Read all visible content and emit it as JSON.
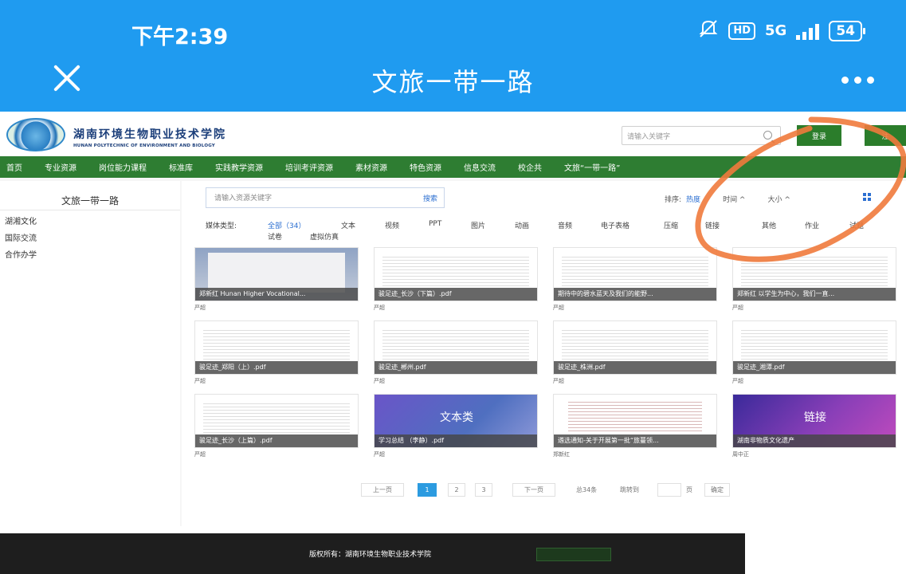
{
  "status_bar": {
    "time": "下午2:39",
    "network": "5G",
    "battery": "54"
  },
  "app_bar": {
    "title": "文旅一带一路"
  },
  "site": {
    "name_cn": "湖南环境生物职业技术学院",
    "name_en": "HUNAN POLYTECHNIC OF ENVIRONMENT AND BIOLOGY",
    "search_placeholder": "请输入关键字",
    "login_label": "登录",
    "register_label": "注"
  },
  "nav": {
    "items": [
      "首页",
      "专业资源",
      "岗位能力课程",
      "标准库",
      "实践教学资源",
      "培训考评资源",
      "素材资源",
      "特色资源",
      "信息交流",
      "校企共",
      "文旅“一带一路”"
    ]
  },
  "sidebar": {
    "title": "文旅一带一路",
    "items": [
      "湖湘文化",
      "国际交流",
      "合作办学"
    ]
  },
  "resource_search": {
    "placeholder": "请输入资源关键字",
    "button": "搜索"
  },
  "sort": {
    "label": "排序:",
    "options": [
      "热度",
      "时间 ^",
      "大小 ^"
    ]
  },
  "media": {
    "label": "媒体类型:",
    "options": [
      "全部（34）",
      "文本",
      "视频",
      "PPT",
      "图片",
      "动画",
      "音频",
      "电子表格",
      "压缩",
      "链接",
      "其他",
      "作业",
      "试题",
      "试卷",
      "虚拟仿真"
    ]
  },
  "cards": [
    {
      "title": "郑新红 Hunan Higher Vocational...",
      "author": "严超",
      "style": "cert"
    },
    {
      "title": "骏足迹_长沙（下篇）.pdf",
      "author": "严超",
      "style": "doc"
    },
    {
      "title": "期待中的碧水蓝天及我们的能野...",
      "author": "严超",
      "style": "doc"
    },
    {
      "title": "郑新红 以学生为中心，我们一直...",
      "author": "严超",
      "style": "doc"
    },
    {
      "title": "骏足迹_郑阳（上）.pdf",
      "author": "严超",
      "style": "doc"
    },
    {
      "title": "骏足迹_郴州.pdf",
      "author": "严超",
      "style": "doc"
    },
    {
      "title": "骏足迹_株洲.pdf",
      "author": "严超",
      "style": "doc"
    },
    {
      "title": "骏足迹_湘潭.pdf",
      "author": "严超",
      "style": "doc"
    },
    {
      "title": "骏足迹_长沙（上篇）.pdf",
      "author": "严超",
      "style": "doc"
    },
    {
      "title": "学习总结 （李静）.pdf",
      "author": "严超",
      "style": "purple1",
      "thumb_text": "文本类"
    },
    {
      "title": "遴选通知-关于开展第一批“旅蔓领...",
      "author": "郑新红",
      "style": "red-doc"
    },
    {
      "title": "湖南非物质文化遗产",
      "author": "周中正",
      "style": "purple2",
      "thumb_text": "链接"
    }
  ],
  "pagination": {
    "prev": "上一页",
    "pages": [
      "1",
      "2",
      "3"
    ],
    "next": "下一页",
    "total": "总34条",
    "goto": "跳转到",
    "page_unit": "页",
    "confirm": "确定"
  },
  "footer": {
    "copyright": "版权所有：湖南环境生物职业技术学院"
  },
  "colors": {
    "app_bar": "#1f9bf0",
    "nav_green": "#2e7d32",
    "accent_blue": "#2c6fd1",
    "annotation_orange": "#ef7a3c"
  }
}
